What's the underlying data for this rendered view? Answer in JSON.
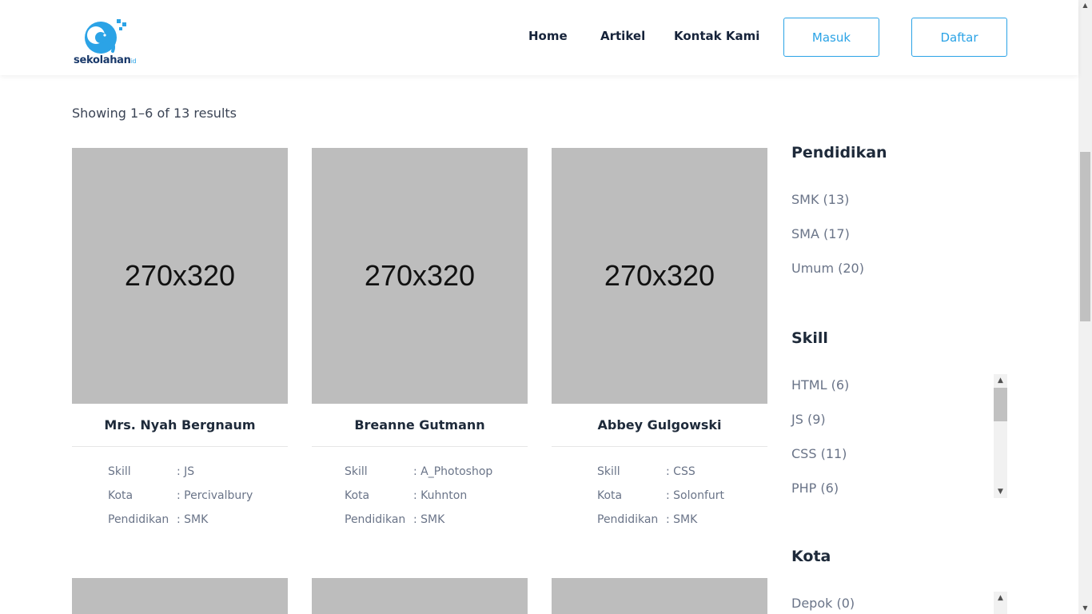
{
  "header": {
    "logo_text": "sekolahan",
    "logo_tail": "id",
    "nav": {
      "home": "Home",
      "artikel": "Artikel",
      "kontak": "Kontak Kami"
    },
    "masuk": "Masuk",
    "daftar": "Daftar"
  },
  "results_text": "Showing 1–6 of 13 results",
  "cards": [
    {
      "image": "270x320",
      "name": "Mrs. Nyah Bergnaum",
      "skill": ": JS",
      "kota": ": Percivalbury",
      "pendidikan": ": SMK"
    },
    {
      "image": "270x320",
      "name": "Breanne Gutmann",
      "skill": ": A_Photoshop",
      "kota": ": Kuhnton",
      "pendidikan": ": SMK"
    },
    {
      "image": "270x320",
      "name": "Abbey Gulgowski",
      "skill": ": CSS",
      "kota": ": Solonfurt",
      "pendidikan": ": SMK"
    }
  ],
  "meta_labels": {
    "skill": "Skill",
    "kota": "Kota",
    "pendidikan": "Pendidikan"
  },
  "sidebar": {
    "pendidikan": {
      "title": "Pendidikan",
      "items": [
        "SMK (13)",
        "SMA (17)",
        "Umum (20)"
      ]
    },
    "skill": {
      "title": "Skill",
      "items": [
        "HTML (6)",
        "JS (9)",
        "CSS (11)",
        "PHP (6)"
      ]
    },
    "kota": {
      "title": "Kota",
      "items": [
        "Depok (0)"
      ]
    }
  },
  "colors": {
    "accent": "#2ba3e6",
    "brand_dark": "#1a3a6b",
    "placeholder": "#bdbdbd"
  }
}
